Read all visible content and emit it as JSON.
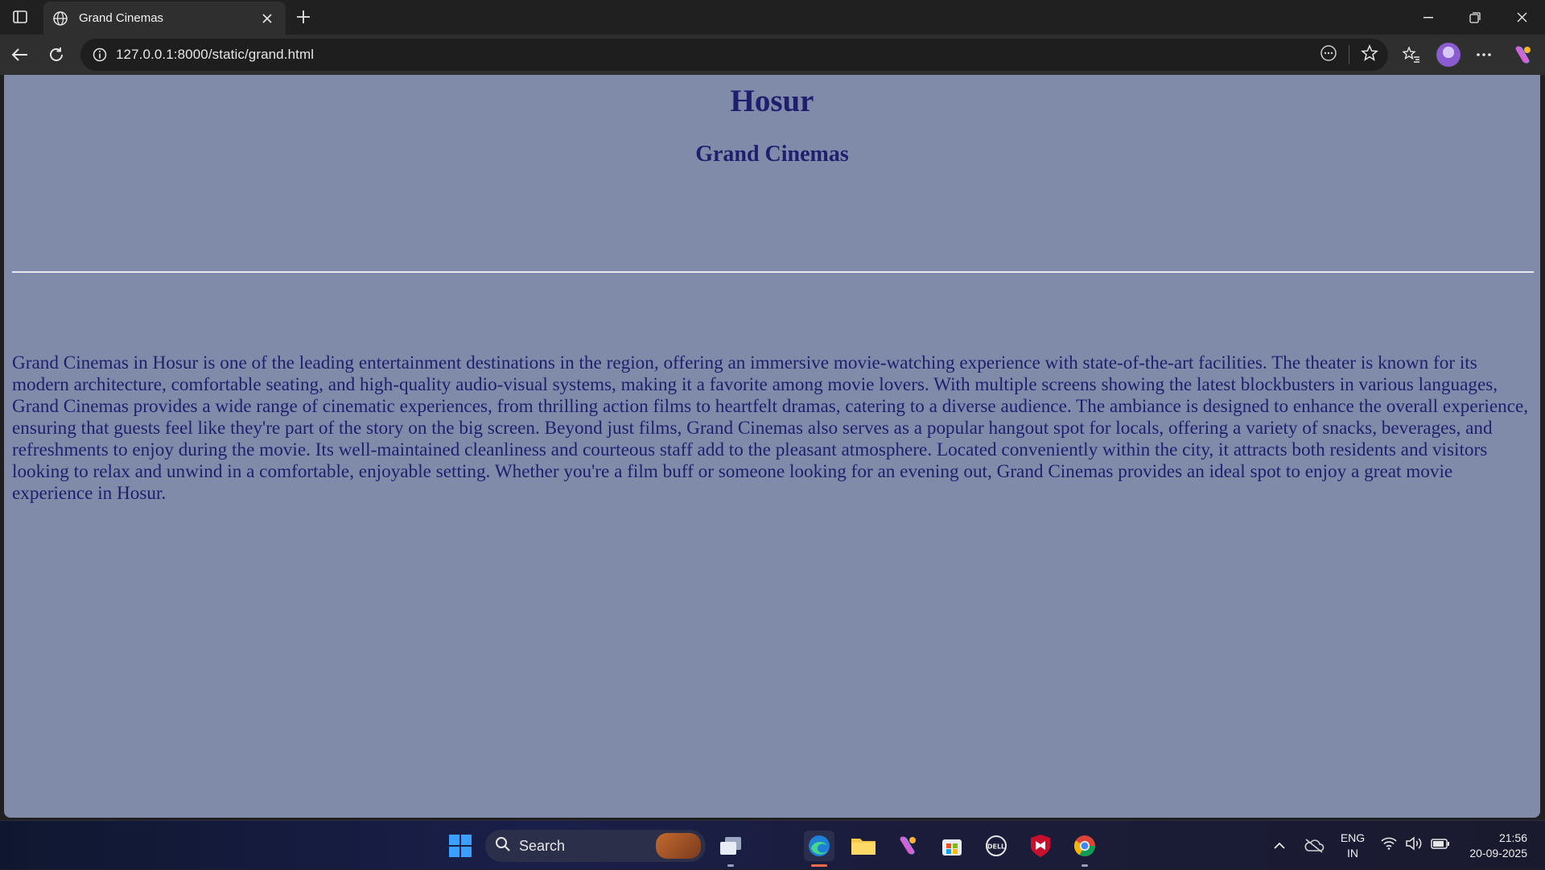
{
  "browser": {
    "tab_title": "Grand Cinemas",
    "url": "127.0.0.1:8000/static/grand.html"
  },
  "page": {
    "heading": "Hosur",
    "subheading": "Grand Cinemas",
    "paragraph": "Grand Cinemas in Hosur is one of the leading entertainment destinations in the region, offering an immersive movie-watching experience with state-of-the-art facilities. The theater is known for its modern architecture, comfortable seating, and high-quality audio-visual systems, making it a favorite among movie lovers. With multiple screens showing the latest blockbusters in various languages, Grand Cinemas provides a wide range of cinematic experiences, from thrilling action films to heartfelt dramas, catering to a diverse audience. The ambiance is designed to enhance the overall experience, ensuring that guests feel like they're part of the story on the big screen. Beyond just films, Grand Cinemas also serves as a popular hangout spot for locals, offering a variety of snacks, beverages, and refreshments to enjoy during the movie. Its well-maintained cleanliness and courteous staff add to the pleasant atmosphere. Located conveniently within the city, it attracts both residents and visitors looking to relax and unwind in a comfortable, enjoyable setting. Whether you're a film buff or someone looking for an evening out, Grand Cinemas provides an ideal spot to enjoy a great movie experience in Hosur.",
    "background_color": "#7f8ba9",
    "text_color": "#1f1f6e"
  },
  "taskbar": {
    "search_label": "Search",
    "language": "ENG",
    "region": "IN",
    "time": "21:56",
    "date": "20-09-2025"
  }
}
